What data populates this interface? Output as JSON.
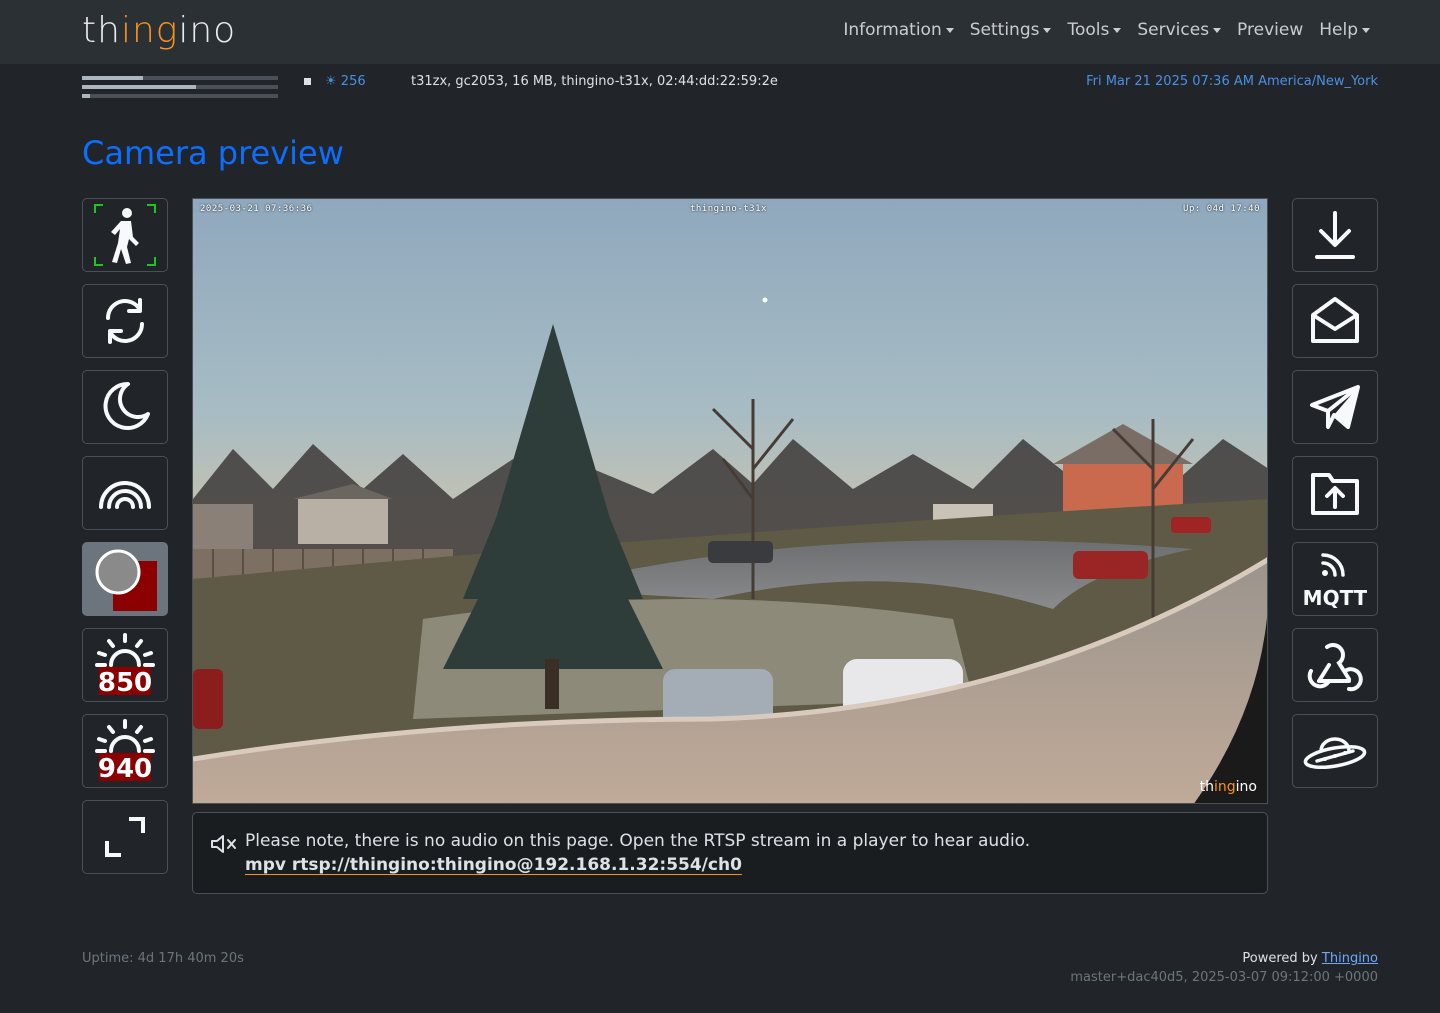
{
  "navbar": {
    "brand_pre": "th",
    "brand_mid": "ing",
    "brand_post": "ino",
    "menu": [
      {
        "label": "Information",
        "has_caret": true
      },
      {
        "label": "Settings",
        "has_caret": true
      },
      {
        "label": "Tools",
        "has_caret": true
      },
      {
        "label": "Services",
        "has_caret": true
      },
      {
        "label": "Preview",
        "has_caret": false
      },
      {
        "label": "Help",
        "has_caret": true
      }
    ]
  },
  "status": {
    "load_bars": [
      0.31,
      0.58,
      0.04
    ],
    "light_value": "256",
    "light_icon": "sun-icon",
    "device_info": "t31zx, gc2053, 16 MB, thingino-t31x, 02:44:dd:22:59:2e",
    "datetime": "Fri Mar 21 2025 07:36 AM America/New_York"
  },
  "page": {
    "title": "Camera preview"
  },
  "left_controls": [
    {
      "icon": "motion-detection-icon",
      "active": false
    },
    {
      "icon": "rotate-icon",
      "active": false
    },
    {
      "icon": "night-mode-icon",
      "active": false
    },
    {
      "icon": "color-mode-icon",
      "active": false
    },
    {
      "icon": "record-icon",
      "active": true
    },
    {
      "icon": "ir850-icon",
      "label": "850",
      "active": false
    },
    {
      "icon": "ir940-icon",
      "label": "940",
      "active": false
    },
    {
      "icon": "fullscreen-icon",
      "active": false
    }
  ],
  "right_controls": [
    {
      "icon": "download-icon"
    },
    {
      "icon": "email-icon"
    },
    {
      "icon": "telegram-icon"
    },
    {
      "icon": "upload-folder-icon"
    },
    {
      "icon": "mqtt-icon",
      "label": "MQTT"
    },
    {
      "icon": "webhook-icon"
    },
    {
      "icon": "ufo-icon"
    }
  ],
  "preview": {
    "osd_left": "2025-03-21 07:36:36",
    "osd_center": "thingino-t31x",
    "osd_right": "Up: 04d 17:40",
    "watermark_pre": "th",
    "watermark_mid": "ing",
    "watermark_post": "ino"
  },
  "alert": {
    "text": "Please note, there is no audio on this page. Open the RTSP stream in a player to hear audio.",
    "command": "mpv rtsp://thingino:thingino@192.168.1.32:554/ch0"
  },
  "footer": {
    "uptime": "Uptime: 4d 17h 40m 20s",
    "powered_by": "Powered by",
    "powered_link": "Thingino",
    "build": "master+dac40d5, 2025-03-07 09:12:00 +0000"
  },
  "colors": {
    "background": "#212529",
    "navbar": "#2b3035",
    "accent": "#0d6efd",
    "brand_orange": "#f7931e",
    "record_red": "#8b0000"
  }
}
